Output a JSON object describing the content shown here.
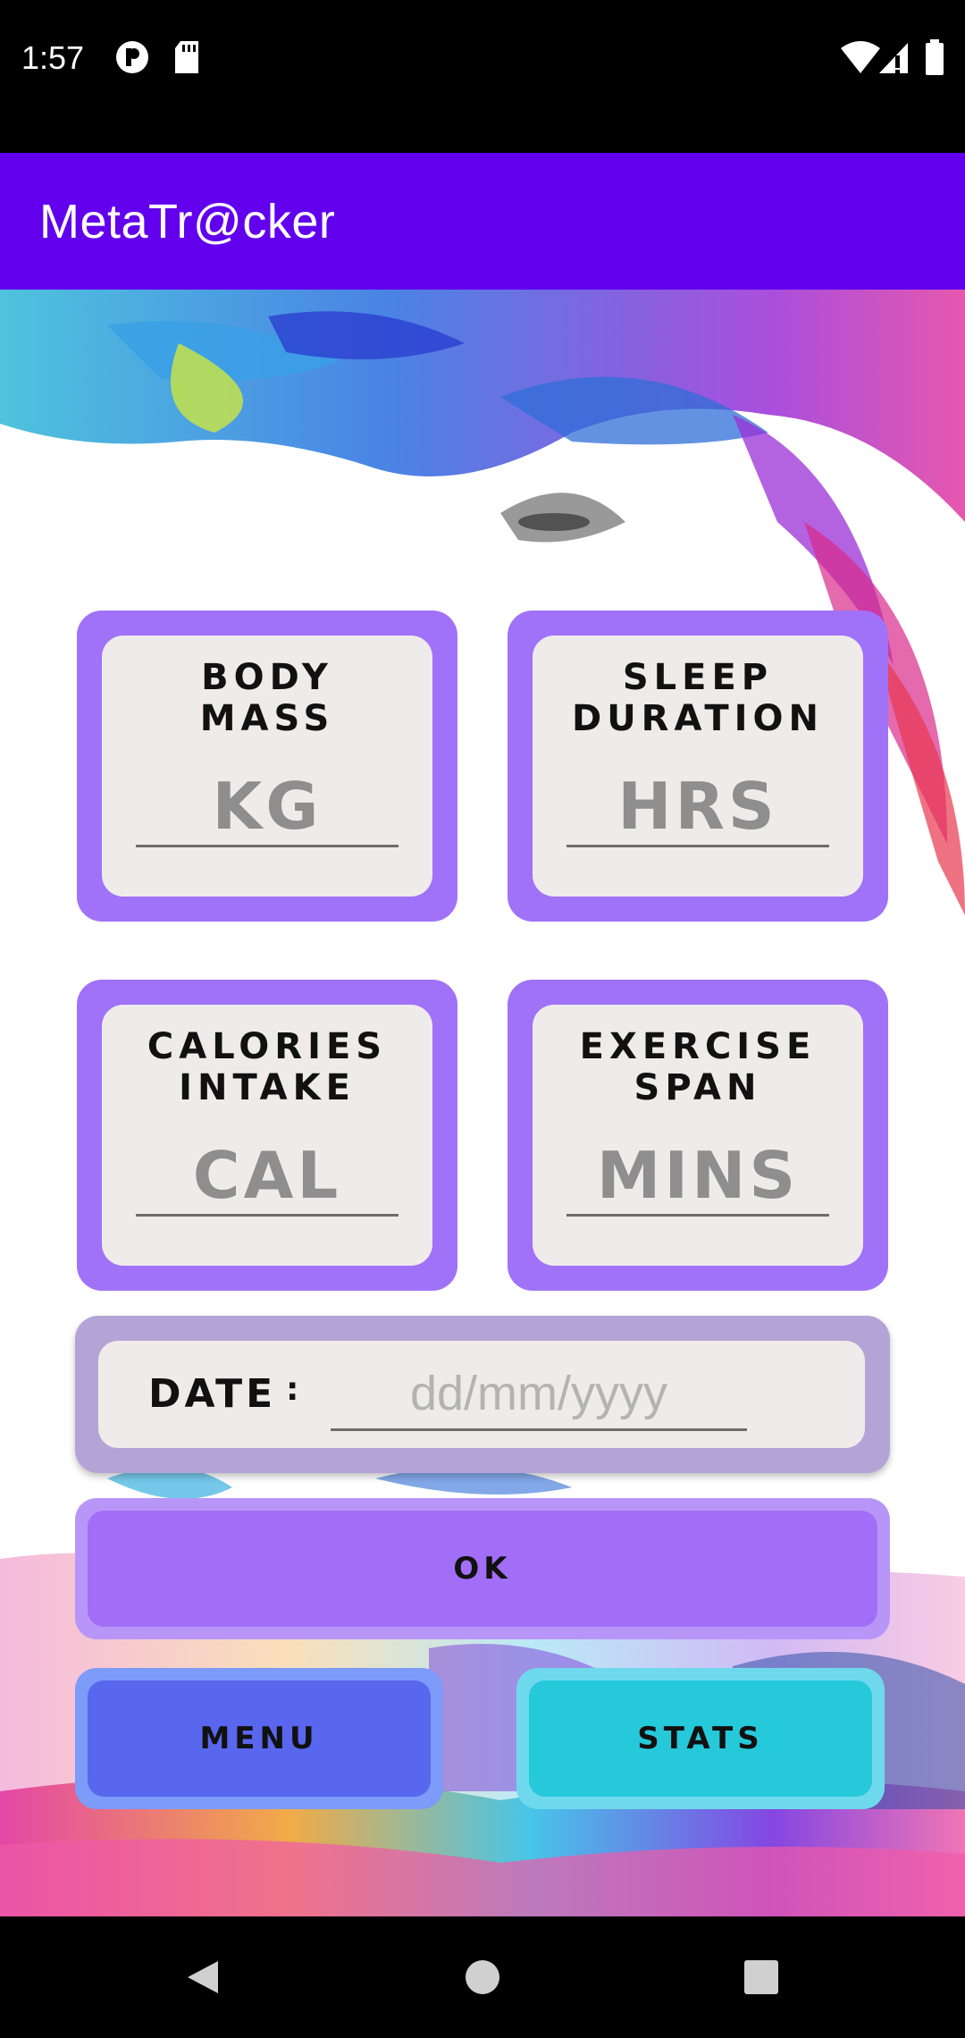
{
  "status_bar": {
    "time": "1:57",
    "icons": [
      "p-app-icon",
      "sd-card-icon",
      "wifi-icon",
      "signal-icon",
      "battery-icon"
    ]
  },
  "app_bar": {
    "title": "MetaTr@cker"
  },
  "cards": [
    {
      "title": "BODY\nMASS",
      "placeholder": "KG"
    },
    {
      "title": "SLEEP\nDURATION",
      "placeholder": "HRS"
    },
    {
      "title": "CALORIES\nINTAKE",
      "placeholder": "CAL"
    },
    {
      "title": "EXERCISE\nSPAN",
      "placeholder": "MINS"
    }
  ],
  "date": {
    "label": "DATE",
    "separator": ":",
    "placeholder": "dd/mm/yyyy"
  },
  "buttons": {
    "ok": "OK",
    "menu": "MENU",
    "stats": "STATS"
  },
  "colors": {
    "app_bar": "#6200EE",
    "card": "#A072F7",
    "ok": "#A26EF7",
    "menu": "#5967EE",
    "stats": "#26C9DA"
  },
  "nav_bar": {
    "icons": [
      "back-icon",
      "home-icon",
      "recents-icon"
    ]
  }
}
